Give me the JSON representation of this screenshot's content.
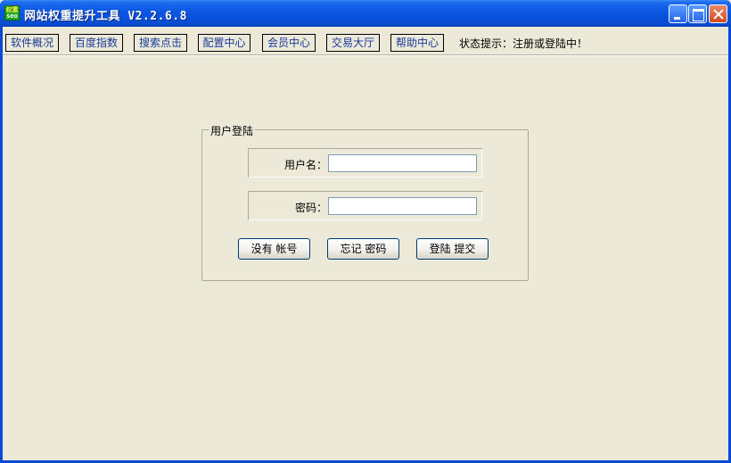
{
  "window": {
    "title": "网站权重提升工具 V2.2.6.8",
    "icon_text_top": "权重",
    "icon_text_bottom": "seo"
  },
  "menu": {
    "items": [
      {
        "label": "软件概况"
      },
      {
        "label": "百度指数"
      },
      {
        "label": "搜索点击"
      },
      {
        "label": "配置中心"
      },
      {
        "label": "会员中心"
      },
      {
        "label": "交易大厅"
      },
      {
        "label": "帮助中心"
      }
    ],
    "status_text": "状态提示：注册或登陆中！"
  },
  "login": {
    "group_title": "用户登陆",
    "username_label": "用户名：",
    "username_value": "",
    "password_label": "密码：",
    "password_value": "",
    "buttons": {
      "register": "没有 帐号",
      "forgot": "忘记 密码",
      "submit": "登陆 提交"
    }
  },
  "colors": {
    "titlebar": "#0b58e4",
    "client_bg": "#ece9d8",
    "menu_text": "#1a3a9a",
    "close_button": "#cf4a20"
  }
}
